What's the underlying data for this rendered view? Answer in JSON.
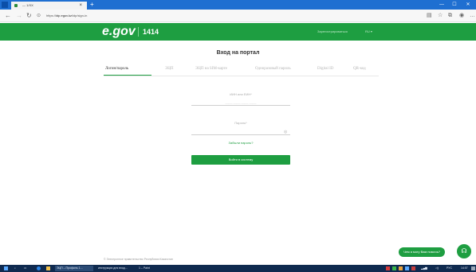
{
  "browser": {
    "tab_title": "— 1/XX",
    "url_prefix": "https://",
    "url_host": "idp.egov.kz",
    "url_path": "/idp/sign-in",
    "tab_close": "×",
    "new_tab": "+",
    "min": "—",
    "max": "☐",
    "close": "✕"
  },
  "header": {
    "logo": "e.gov",
    "number": "1414",
    "link": "Зарегистрироваться",
    "lang": "RU ▾"
  },
  "login": {
    "title": "Вход на портал",
    "tabs": [
      "Логин/пароль",
      "ЭЦП",
      "ЭЦП на SIM-карте",
      "Одноразовый пароль",
      "Digital ID",
      "QR-код"
    ],
    "iin_label": "ИИН или ЕИН*",
    "iin_placeholder": "____ ____ ____ ____",
    "password_label": "Пароль*",
    "forgot": "Забыли пароль?",
    "submit": "Войти в систему"
  },
  "footer": {
    "copyright": "© Электронное правительство Республики Казахстан"
  },
  "chat": {
    "bubble": "Чем я могу Вам помочь?",
    "icon": "headset-icon"
  },
  "taskbar": {
    "app1": "ЭЦП – Профиль 1…",
    "app2": "инструкция для вход…",
    "app3": "1 – Paint",
    "lang": "РУС",
    "time": "14:07"
  },
  "colors": {
    "brand_green": "#1e9e41",
    "taskbar": "#0f2a4f",
    "chrome_blue": "#1f6fd1"
  }
}
